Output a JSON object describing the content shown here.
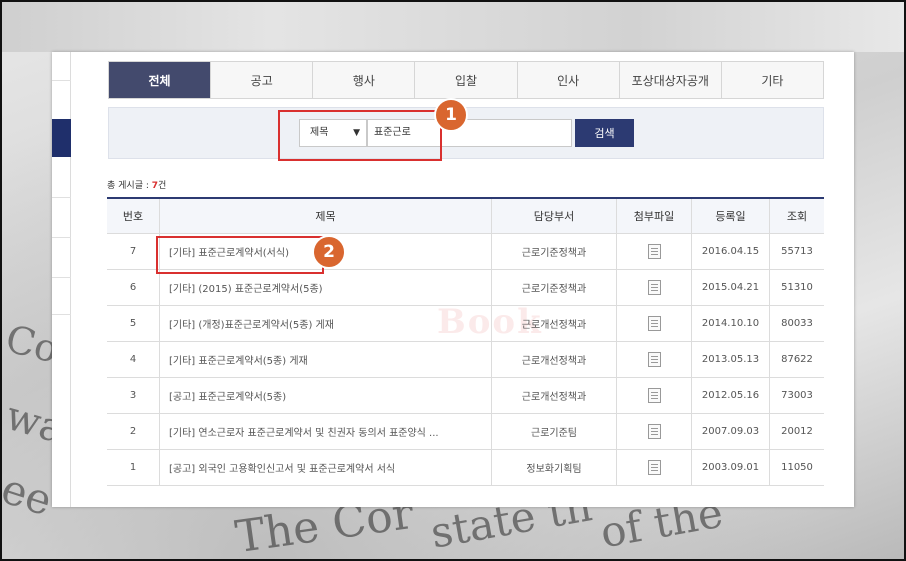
{
  "background": {
    "text_lines": [
      "Co",
      "wa",
      "ee",
      "The Cor",
      "state th",
      "of the"
    ]
  },
  "tabs": [
    {
      "label": "전체",
      "active": true
    },
    {
      "label": "공고",
      "active": false
    },
    {
      "label": "행사",
      "active": false
    },
    {
      "label": "입찰",
      "active": false
    },
    {
      "label": "인사",
      "active": false
    },
    {
      "label": "포상대상자공개",
      "active": false
    },
    {
      "label": "기타",
      "active": false
    }
  ],
  "search": {
    "select_value": "제목",
    "select_chevron": "chevron-down-icon",
    "query": "표준근로",
    "button_label": "검색"
  },
  "annotations": {
    "badge1": "1",
    "badge2": "2",
    "highlight_color": "#d9302f",
    "badge_color": "#d9662f"
  },
  "total": {
    "label": "총 게시글 : ",
    "count": "7",
    "unit": "건"
  },
  "table": {
    "headers": {
      "no": "번호",
      "title": "제목",
      "dept": "담당부서",
      "file": "첨부파일",
      "date": "등록일",
      "views": "조회"
    },
    "rows": [
      {
        "no": "7",
        "title": "[기타] 표준근로계약서(서식)",
        "dept": "근로기준정책과",
        "file": "document-icon",
        "date": "2016.04.15",
        "views": "55713"
      },
      {
        "no": "6",
        "title": "[기타] (2015) 표준근로계약서(5종)",
        "dept": "근로기준정책과",
        "file": "document-icon",
        "date": "2015.04.21",
        "views": "51310"
      },
      {
        "no": "5",
        "title": "[기타] (개정)표준근로계약서(5종) 게재",
        "dept": "근로개선정책과",
        "file": "document-icon",
        "date": "2014.10.10",
        "views": "80033"
      },
      {
        "no": "4",
        "title": "[기타] 표준근로계약서(5종) 게재",
        "dept": "근로개선정책과",
        "file": "document-icon",
        "date": "2013.05.13",
        "views": "87622"
      },
      {
        "no": "3",
        "title": "[공고] 표준근로계약서(5종)",
        "dept": "근로개선정책과",
        "file": "document-icon",
        "date": "2012.05.16",
        "views": "73003"
      },
      {
        "no": "2",
        "title": "[기타] 연소근로자 표준근로계약서 및 친권자 동의서 표준양식 ...",
        "dept": "근로기준팀",
        "file": "document-icon",
        "date": "2007.09.03",
        "views": "20012"
      },
      {
        "no": "1",
        "title": "[공고] 외국인 고용확인신고서 및 표준근로계약서 서식",
        "dept": "정보화기획팀",
        "file": "document-icon",
        "date": "2003.09.01",
        "views": "11050"
      }
    ]
  },
  "watermark": "Book",
  "colors": {
    "tab_active": "#434a6d",
    "navy": "#2c3a72",
    "sidebar_active": "#1f2f6b"
  }
}
